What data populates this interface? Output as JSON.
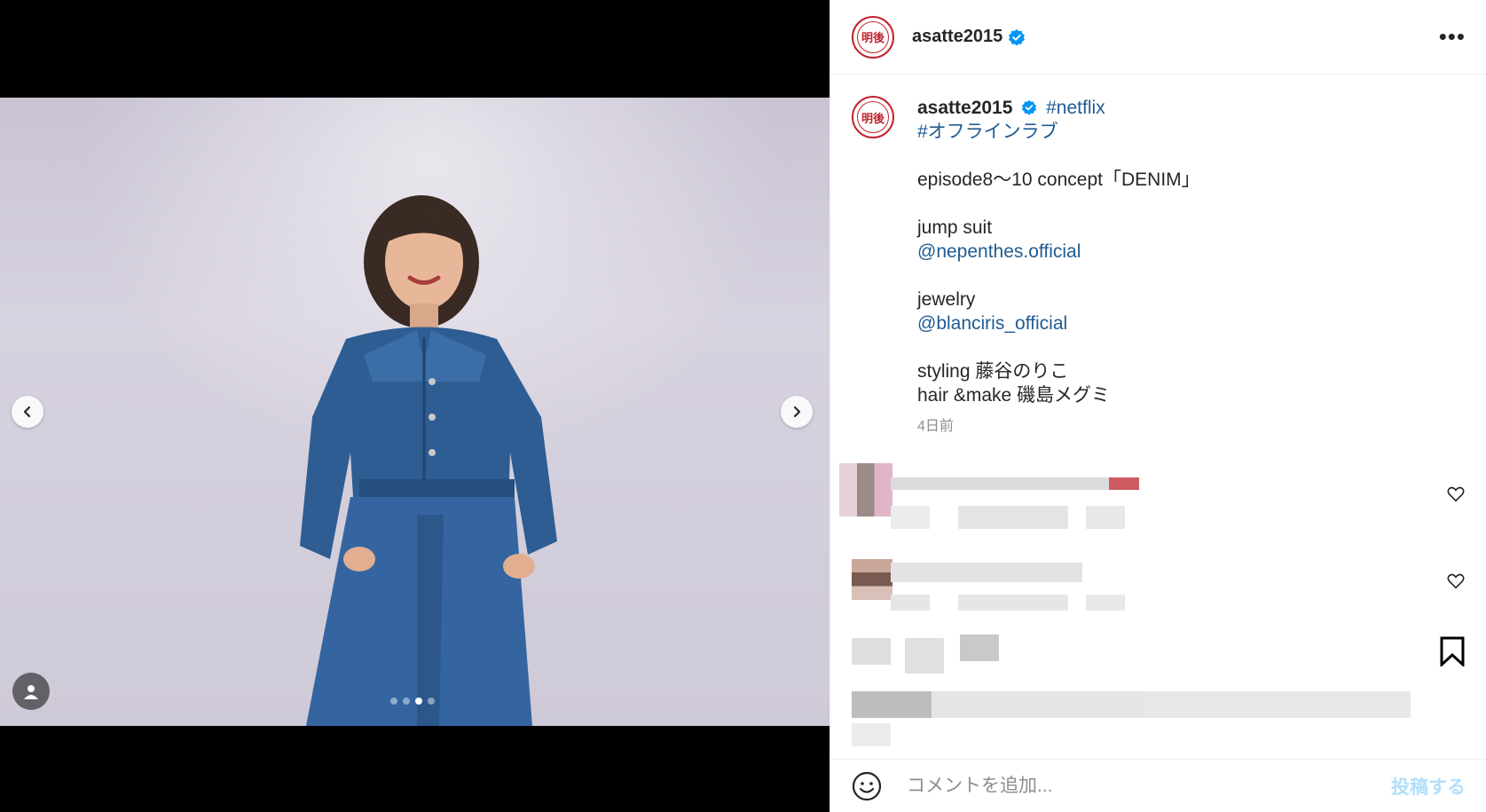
{
  "post": {
    "username": "asatte2015",
    "avatar_text": "明後",
    "caption_lines": [
      {
        "text": "#netflix",
        "kind": "link",
        "inline_after_user": true
      },
      {
        "text": "#オフラインラブ",
        "kind": "link"
      },
      {
        "text": "",
        "kind": "blank"
      },
      {
        "text": "episode8～10 concept「DENIM」",
        "kind": "text"
      },
      {
        "text": "",
        "kind": "blank"
      },
      {
        "text": "jump suit",
        "kind": "text"
      },
      {
        "text": "@nepenthes.official",
        "kind": "link"
      },
      {
        "text": "",
        "kind": "blank"
      },
      {
        "text": "jewelry",
        "kind": "text"
      },
      {
        "text": "@blanciris_official",
        "kind": "link"
      },
      {
        "text": "",
        "kind": "blank"
      },
      {
        "text": "styling 藤谷のりこ",
        "kind": "text"
      },
      {
        "text": "hair &make 磯島メグミ",
        "kind": "text"
      }
    ],
    "time": "4日前"
  },
  "media": {
    "carousel_count": 4,
    "carousel_active": 2
  },
  "comment_box": {
    "placeholder": "コメントを追加...",
    "post_label": "投稿する"
  },
  "colors": {
    "link": "#1f5b93",
    "verified": "#0095f6",
    "brand_red": "#c0242b"
  }
}
